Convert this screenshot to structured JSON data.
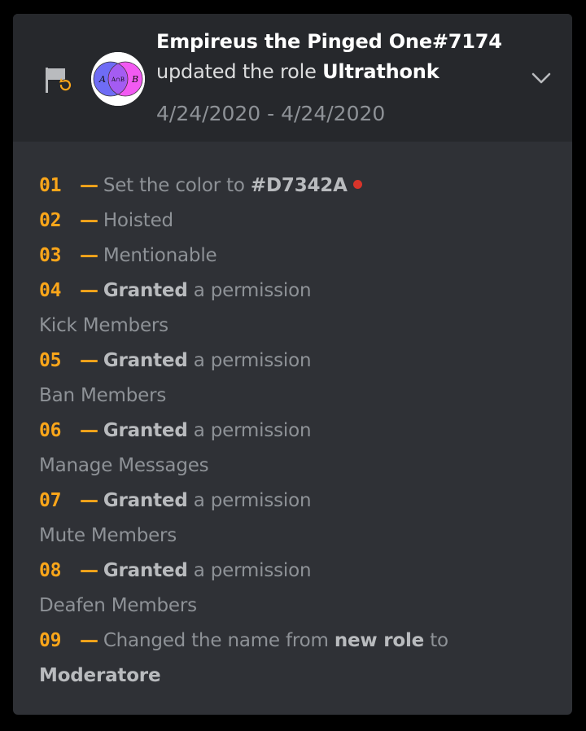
{
  "entry": {
    "user": "Empireus the Pinged One#7174",
    "action_prefix": "updated the role",
    "target": "Ultrathonk",
    "date_range": "4/24/2020 - 4/24/2020",
    "icon": "flag-update-icon",
    "avatar_icon": "venn-diagram-avatar",
    "avatar_labels": {
      "a": "A",
      "b": "B",
      "ab": "A∩B"
    }
  },
  "changes": [
    {
      "num": "01",
      "dash": "—",
      "text": "Set the color to",
      "value": "#D7342A",
      "color_swatch": "#D7342A"
    },
    {
      "num": "02",
      "dash": "—",
      "text": "Hoisted"
    },
    {
      "num": "03",
      "dash": "—",
      "text": "Mentionable"
    },
    {
      "num": "04",
      "dash": "—",
      "verb": "Granted",
      "text": "a permission",
      "permission": "Kick Members"
    },
    {
      "num": "05",
      "dash": "—",
      "verb": "Granted",
      "text": "a permission",
      "permission": "Ban Members"
    },
    {
      "num": "06",
      "dash": "—",
      "verb": "Granted",
      "text": "a permission",
      "permission": "Manage Messages"
    },
    {
      "num": "07",
      "dash": "—",
      "verb": "Granted",
      "text": "a permission",
      "permission": "Mute Members"
    },
    {
      "num": "08",
      "dash": "—",
      "verb": "Granted",
      "text": "a permission",
      "permission": "Deafen Members"
    },
    {
      "num": "09",
      "dash": "—",
      "text": "Changed the name from",
      "old_name": "new role",
      "joiner": "to",
      "new_name": "Moderatore"
    }
  ],
  "colors": {
    "accent_orange": "#faa61a",
    "header_bg": "#26282c",
    "body_bg": "#2f3136"
  }
}
